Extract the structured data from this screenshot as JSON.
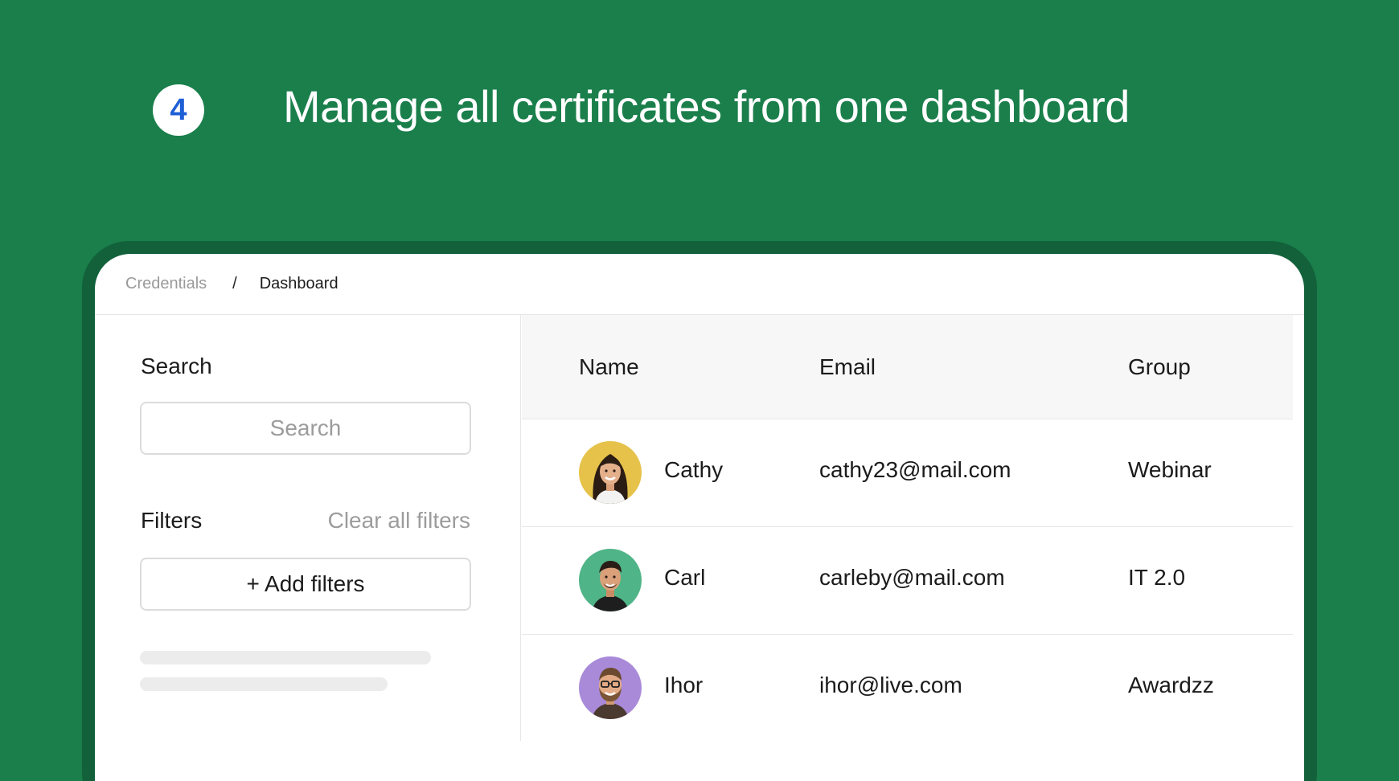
{
  "hero": {
    "step_number": "4",
    "headline": "Manage all certificates from one dashboard"
  },
  "breadcrumb": {
    "parent": "Credentials",
    "separator": "/",
    "current": "Dashboard"
  },
  "sidebar": {
    "search_heading": "Search",
    "search_placeholder": "Search",
    "search_value": "",
    "filters_label": "Filters",
    "clear_filters_label": "Clear all filters",
    "add_filters_label": "+ Add filters"
  },
  "table": {
    "columns": [
      "Name",
      "Email",
      "Group"
    ],
    "rows": [
      {
        "name": "Cathy",
        "email": "cathy23@mail.com",
        "group": "Webinar",
        "avatar_bg": "#e6c24a"
      },
      {
        "name": "Carl",
        "email": "carleby@mail.com",
        "group": "IT 2.0",
        "avatar_bg": "#4fb487"
      },
      {
        "name": "Ihor",
        "email": "ihor@live.com",
        "group": "Awardzz",
        "avatar_bg": "#a98ad9"
      }
    ]
  },
  "colors": {
    "background": "#1a7f4b",
    "frame": "#12613a",
    "badge_number": "#1f5fd6"
  }
}
